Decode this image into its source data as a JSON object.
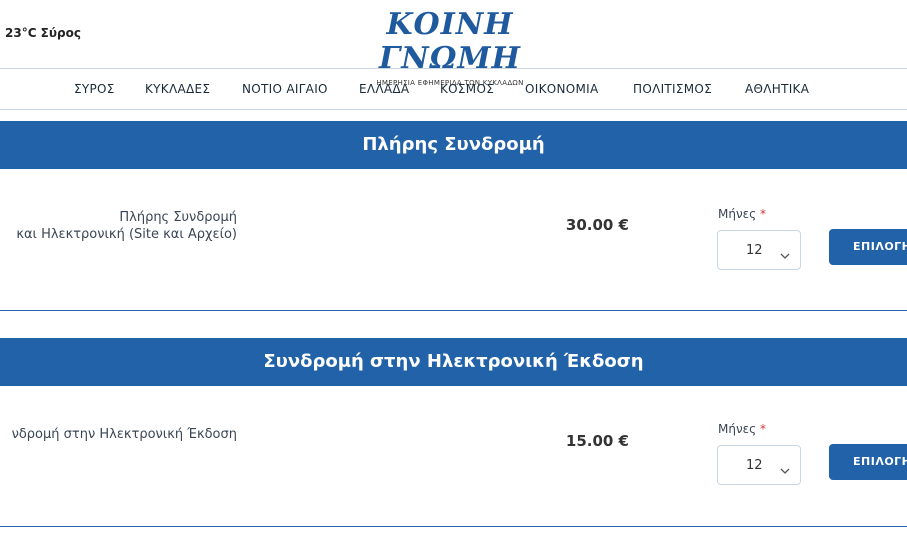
{
  "header": {
    "weather": "23°C Σύρος",
    "logo_title": "ΚΟΙΝΗ ΓΝΩΜΗ",
    "logo_subtitle": "ΗΜΕΡΗΣΙΑ ΕΦΗΜΕΡΙΔΑ ΤΩΝ ΚΥΚΛΑΔΩΝ"
  },
  "nav": {
    "items": [
      "ΣΥΡΟΣ",
      "ΚΥΚΛΑΔΕΣ",
      "ΝΟΤΙΟ ΑΙΓΑΙΟ",
      "ΕΛΛΑΔΑ",
      "ΚΟΣΜΟΣ",
      "ΟΙΚΟΝΟΜΙΑ",
      "ΠΟΛΙΤΙΣΜΟΣ",
      "ΑΘΛΗΤΙΚΑ"
    ]
  },
  "plans": [
    {
      "title": "Πλήρης Συνδρομή",
      "desc_line1": "Πλήρης Συνδρομή",
      "desc_line2": "και Ηλεκτρονική (Site και Αρχείο)",
      "price": "30.00 €",
      "months_label": "Μήνες",
      "required_mark": "*",
      "months_value": "12",
      "button": "ΕΠΙΛΟΓΗ"
    },
    {
      "title": "Συνδρομή στην Ηλεκτρονική Έκδοση",
      "desc_line1": "νδρομή στην Ηλεκτρονική Έκδοση",
      "price": "15.00 €",
      "months_label": "Μήνες",
      "required_mark": "*",
      "months_value": "12",
      "button": "ΕΠΙΛΟΓΗ"
    }
  ]
}
